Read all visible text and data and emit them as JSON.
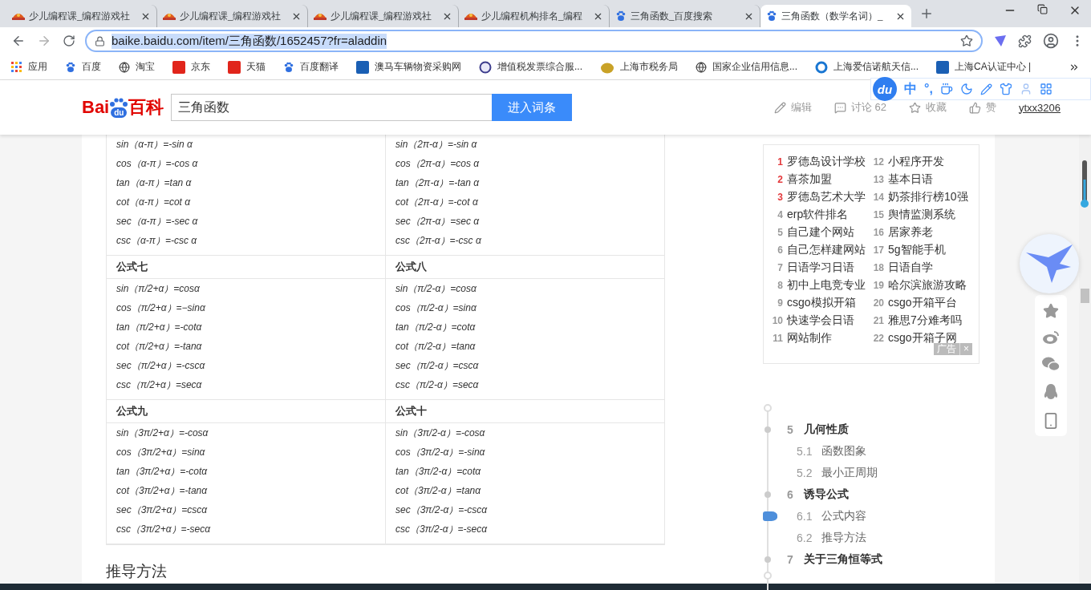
{
  "browser": {
    "tabs": [
      {
        "title": "少儿编程课_编程游戏社",
        "selected": false
      },
      {
        "title": "少儿编程课_编程游戏社",
        "selected": false
      },
      {
        "title": "少儿编程课_编程游戏社",
        "selected": false
      },
      {
        "title": "少儿编程机构排名_编程",
        "selected": false
      },
      {
        "title": "三角函数_百度搜索",
        "selected": false
      },
      {
        "title": "三角函数（数学名词）_",
        "selected": true
      }
    ],
    "url_host": "baike.baidu.com",
    "url_path": "/item/三角函数/1652457?fr=aladdin",
    "bookmarks": [
      {
        "label": "应用"
      },
      {
        "label": "百度"
      },
      {
        "label": "淘宝"
      },
      {
        "label": "京东"
      },
      {
        "label": "天猫"
      },
      {
        "label": "百度翻译"
      },
      {
        "label": "澳马车辆物资采购网"
      },
      {
        "label": "增值税发票综合服..."
      },
      {
        "label": "上海市税务局"
      },
      {
        "label": "国家企业信用信息..."
      },
      {
        "label": "上海爱信诺航天信..."
      },
      {
        "label": "上海CA认证中心 |"
      }
    ],
    "ime": {
      "logo": "du",
      "mode": "中",
      "punct": "°,"
    }
  },
  "header": {
    "logo_left": "Bai",
    "logo_mid": "du",
    "logo_right": "百科",
    "search_value": "三角函数",
    "search_button": "进入词条",
    "actions": [
      {
        "label": "编辑"
      },
      {
        "label": "讨论 62"
      },
      {
        "label": "收藏"
      },
      {
        "label": "赞"
      }
    ],
    "user": "ytxx3206"
  },
  "table": {
    "groups": [
      {
        "left": [
          "sin（α-π）=-sin α",
          "cos（α-π）=-cos α",
          "tan（α-π）=tan α",
          "cot（α-π）=cot α",
          "sec（α-π）=-sec α",
          "csc（α-π）=-csc α"
        ],
        "right": [
          "sin（2π-α）=-sin α",
          "cos（2π-α）=cos α",
          "tan（2π-α）=-tan α",
          "cot（2π-α）=-cot α",
          "sec（2π-α）=sec α",
          "csc（2π-α）=-csc α"
        ]
      },
      {
        "left_title": "公式七",
        "right_title": "公式八",
        "left": [
          "sin（π/2+α）=cosα",
          "cos（π/2+α）=−sinα",
          "tan（π/2+α）=-cotα",
          "cot（π/2+α）=-tanα",
          "sec（π/2+α）=-cscα",
          "csc（π/2+α）=secα"
        ],
        "right": [
          "sin（π/2-α）=cosα",
          "cos（π/2-α）=sinα",
          "tan（π/2-α）=cotα",
          "cot（π/2-α）=tanα",
          "sec（π/2-α）=cscα",
          "csc（π/2-α）=secα"
        ]
      },
      {
        "left_title": "公式九",
        "right_title": "公式十",
        "left": [
          "sin（3π/2+α）=-cosα",
          "cos（3π/2+α）=sinα",
          "tan（3π/2+α）=-cotα",
          "cot（3π/2+α）=-tanα",
          "sec（3π/2+α）=cscα",
          "csc（3π/2+α）=-secα"
        ],
        "right": [
          "sin（3π/2-α）=-cosα",
          "cos（3π/2-α）=-sinα",
          "tan（3π/2-α）=cotα",
          "cot（3π/2-α）=tanα",
          "sec（3π/2-α）=-cscα",
          "csc（3π/2-α）=-secα"
        ]
      }
    ]
  },
  "section_heading": "推导方法",
  "ad": {
    "label": "广告",
    "close": "×",
    "items": [
      {
        "rank": "1",
        "text": "罗德岛设计学校",
        "highlighted": true
      },
      {
        "rank": "2",
        "text": "喜茶加盟",
        "highlighted": true
      },
      {
        "rank": "3",
        "text": "罗德岛艺术大学",
        "highlighted": true
      },
      {
        "rank": "4",
        "text": "erp软件排名",
        "highlighted": false
      },
      {
        "rank": "5",
        "text": "自己建个网站",
        "highlighted": false
      },
      {
        "rank": "6",
        "text": "自己怎样建网站",
        "highlighted": false
      },
      {
        "rank": "7",
        "text": "日语学习日语",
        "highlighted": false
      },
      {
        "rank": "8",
        "text": "初中上电竞专业",
        "highlighted": false
      },
      {
        "rank": "9",
        "text": "csgo模拟开箱",
        "highlighted": false
      },
      {
        "rank": "10",
        "text": "快速学会日语",
        "highlighted": false
      },
      {
        "rank": "11",
        "text": "网站制作",
        "highlighted": false
      },
      {
        "rank": "12",
        "text": "小程序开发",
        "highlighted": false
      },
      {
        "rank": "13",
        "text": "基本日语",
        "highlighted": false
      },
      {
        "rank": "14",
        "text": "奶茶排行榜10强",
        "highlighted": false
      },
      {
        "rank": "15",
        "text": "舆情监测系统",
        "highlighted": false
      },
      {
        "rank": "16",
        "text": "居家养老",
        "highlighted": false
      },
      {
        "rank": "17",
        "text": "5g智能手机",
        "highlighted": false
      },
      {
        "rank": "18",
        "text": "日语自学",
        "highlighted": false
      },
      {
        "rank": "19",
        "text": "哈尔滨旅游攻略",
        "highlighted": false
      },
      {
        "rank": "20",
        "text": "csgo开箱平台",
        "highlighted": false
      },
      {
        "rank": "21",
        "text": "雅思7分难考吗",
        "highlighted": false
      },
      {
        "rank": "22",
        "text": "csgo开箱子网",
        "highlighted": false
      }
    ]
  },
  "toc": [
    {
      "number": "5",
      "title": "几何性质",
      "selected": false,
      "children": [
        {
          "number": "5.1",
          "title": "函数图象",
          "selected": false
        },
        {
          "number": "5.2",
          "title": "最小正周期",
          "selected": false
        }
      ]
    },
    {
      "number": "6",
      "title": "诱导公式",
      "selected": false,
      "children": [
        {
          "number": "6.1",
          "title": "公式内容",
          "selected": true
        },
        {
          "number": "6.2",
          "title": "推导方法",
          "selected": false
        }
      ]
    },
    {
      "number": "7",
      "title": "关于三角恒等式",
      "selected": false
    }
  ]
}
